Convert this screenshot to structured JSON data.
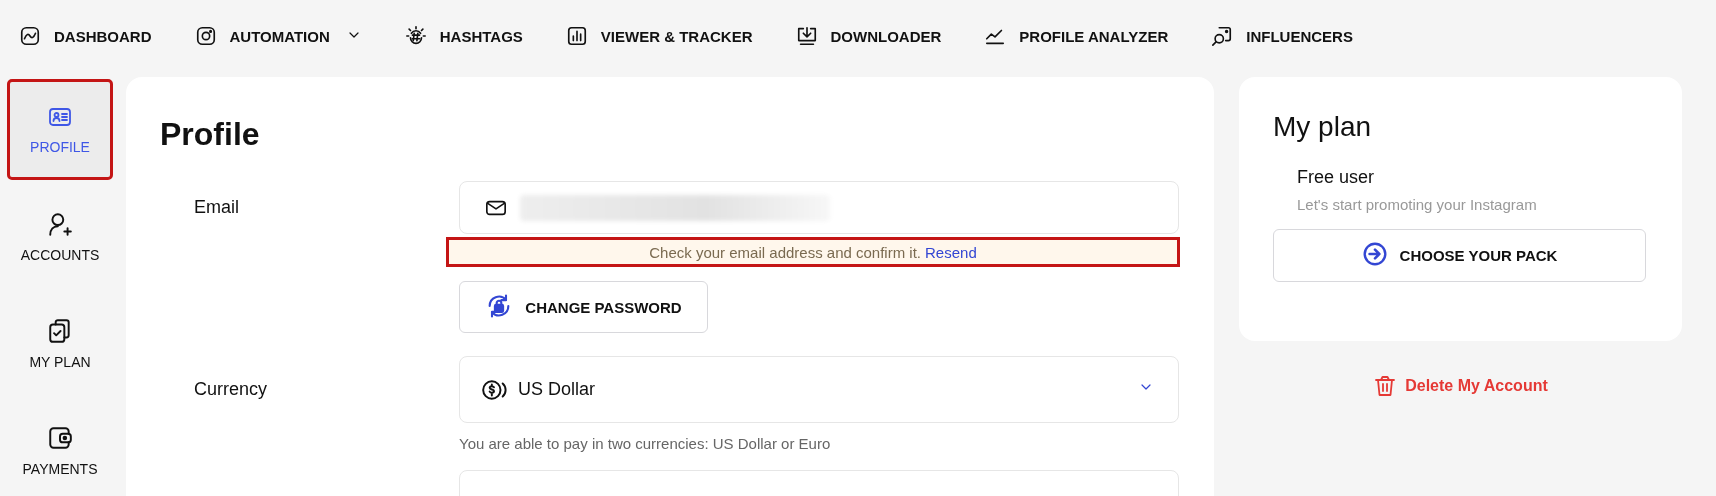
{
  "top_nav": [
    {
      "label": "DASHBOARD",
      "dropdown": false
    },
    {
      "label": "AUTOMATION",
      "dropdown": true
    },
    {
      "label": "HASHTAGS",
      "dropdown": false
    },
    {
      "label": "VIEWER & TRACKER",
      "dropdown": false
    },
    {
      "label": "DOWNLOADER",
      "dropdown": false
    },
    {
      "label": "PROFILE ANALYZER",
      "dropdown": false
    },
    {
      "label": "INFLUENCERS",
      "dropdown": false
    }
  ],
  "sidebar": {
    "items": [
      {
        "label": "PROFILE",
        "selected": true
      },
      {
        "label": "ACCOUNTS",
        "selected": false
      },
      {
        "label": "MY PLAN",
        "selected": false
      },
      {
        "label": "PAYMENTS",
        "selected": false
      }
    ]
  },
  "profile": {
    "title": "Profile",
    "email": {
      "label": "Email",
      "notice": "Check your email address and confirm it.",
      "notice_link": "Resend"
    },
    "change_password": "CHANGE PASSWORD",
    "currency": {
      "label": "Currency",
      "value": "US Dollar",
      "hint": "You are able to pay in two currencies: US Dollar or Euro"
    }
  },
  "plan": {
    "title": "My plan",
    "name": "Free user",
    "subtitle": "Let's start promoting your Instagram",
    "button": "CHOOSE YOUR PACK"
  },
  "delete_account": "Delete My Account"
}
